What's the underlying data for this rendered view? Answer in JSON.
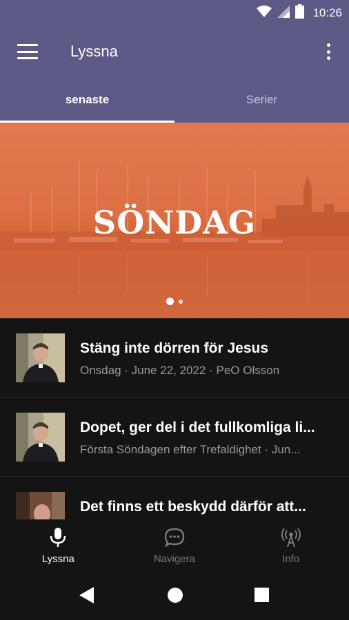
{
  "status_bar": {
    "time": "10:26"
  },
  "app_bar": {
    "title": "Lyssna",
    "menu_icon": "hamburger-menu-icon",
    "overflow_icon": "more-vert-icon"
  },
  "tabs": [
    {
      "label": "senaste",
      "active": true
    },
    {
      "label": "Serier",
      "active": false
    }
  ],
  "hero": {
    "title": "SÖNDAG",
    "page_count": 2,
    "current_page": 1
  },
  "episodes": [
    {
      "title": "Stäng inte dörren för Jesus",
      "subtitle": "Onsdag · June 22, 2022 · PeO Olsson"
    },
    {
      "title": "Dopet, ger del i det fullkomliga li...",
      "subtitle": "Första Söndagen efter Trefaldighet · Jun..."
    },
    {
      "title": "Det finns ett beskydd därför att...",
      "subtitle": ""
    }
  ],
  "bottom_nav": [
    {
      "label": "Lyssna",
      "icon": "microphone-icon",
      "active": true
    },
    {
      "label": "Navigera",
      "icon": "chat-bubble-icon",
      "active": false
    },
    {
      "label": "Info",
      "icon": "antenna-icon",
      "active": false
    }
  ],
  "colors": {
    "primary": "#5d5a87",
    "hero": "#dd6f43",
    "background": "#141414"
  }
}
